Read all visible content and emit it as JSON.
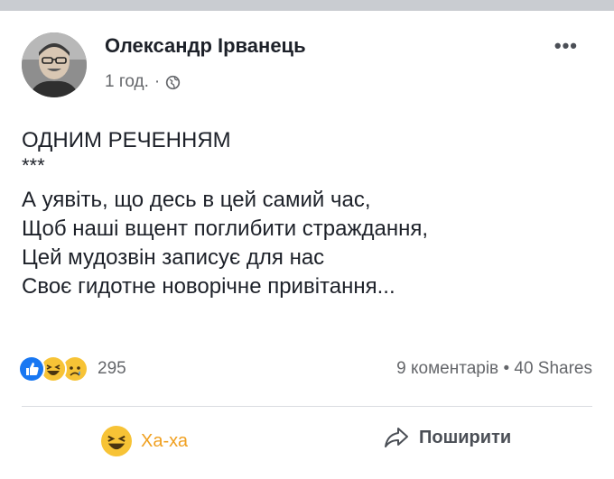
{
  "post": {
    "author": "Олександр Ірванець",
    "time": "1 год.",
    "separator": "·",
    "more": "•••"
  },
  "content": {
    "heading": "ОДНИМ РЕЧЕННЯМ",
    "stars": "***",
    "lines": [
      "А уявіть, що десь в цей самий час,",
      "Щоб наші вщент поглибити страждання,",
      "Цей мудозвін записує для нас",
      "Своє гидотне новорічне привітання..."
    ]
  },
  "reactions": {
    "count": "295",
    "icons": [
      "like-icon",
      "haha-icon",
      "sad-icon"
    ]
  },
  "stats": {
    "comments": "9 коментарів",
    "dot": "•",
    "shares": "40 Shares"
  },
  "actions": {
    "haha_label": "Ха-ха",
    "share_label": "Поширити"
  },
  "colors": {
    "accent_blue": "#1877f2",
    "haha_yellow": "#f0a020",
    "text": "#1d2129",
    "secondary_text": "#65676b"
  }
}
